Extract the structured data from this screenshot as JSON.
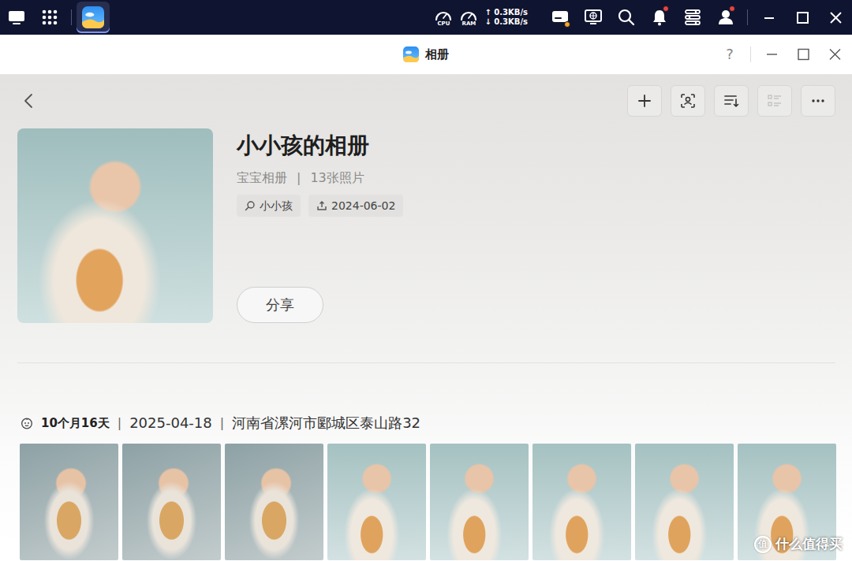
{
  "taskbar": {
    "apps": [
      {
        "kind": "desktop",
        "selected": false
      },
      {
        "kind": "launcher",
        "selected": false
      },
      {
        "kind": "photos",
        "selected": true
      }
    ],
    "gauges": [
      {
        "label": "CPU"
      },
      {
        "label": "RAM"
      }
    ],
    "upload": "↑ 0.3KB/s",
    "download": "↓ 0.3KB/s",
    "tray": [
      {
        "kind": "storage",
        "badge": true,
        "color": "#f5a623"
      },
      {
        "kind": "monitor",
        "badge": false
      },
      {
        "kind": "search",
        "badge": false
      },
      {
        "kind": "bell",
        "badge": true,
        "color": "#e8453c"
      },
      {
        "kind": "controls",
        "badge": false
      },
      {
        "kind": "user",
        "badge": true,
        "color": "#e8453c"
      }
    ]
  },
  "window": {
    "title": "相册",
    "help": "?"
  },
  "toolbar": [
    {
      "kind": "add",
      "disabled": false
    },
    {
      "kind": "face",
      "disabled": false
    },
    {
      "kind": "sort",
      "disabled": false
    },
    {
      "kind": "list",
      "disabled": true
    },
    {
      "kind": "more",
      "disabled": false
    }
  ],
  "album": {
    "title": "小小孩的相册",
    "type": "宝宝相册",
    "separator": "|",
    "count": "13张照片",
    "tags": [
      {
        "kind": "person",
        "label": "小小孩"
      },
      {
        "kind": "date",
        "label": "2024-06-02"
      }
    ],
    "share": "分享"
  },
  "groups": [
    {
      "age": "10个月16天",
      "separator": "|",
      "date": "2025-04-18",
      "location": "河南省漯河市郾城区泰山路32",
      "photos": [
        {
          "kind": "mat"
        },
        {
          "kind": "mat"
        },
        {
          "kind": "mat"
        },
        {
          "kind": "sofa"
        },
        {
          "kind": "sofa"
        },
        {
          "kind": "sofa"
        },
        {
          "kind": "sofa"
        },
        {
          "kind": "sofa"
        }
      ]
    }
  ],
  "watermark": {
    "badge": "值",
    "text": "什么值得买"
  }
}
